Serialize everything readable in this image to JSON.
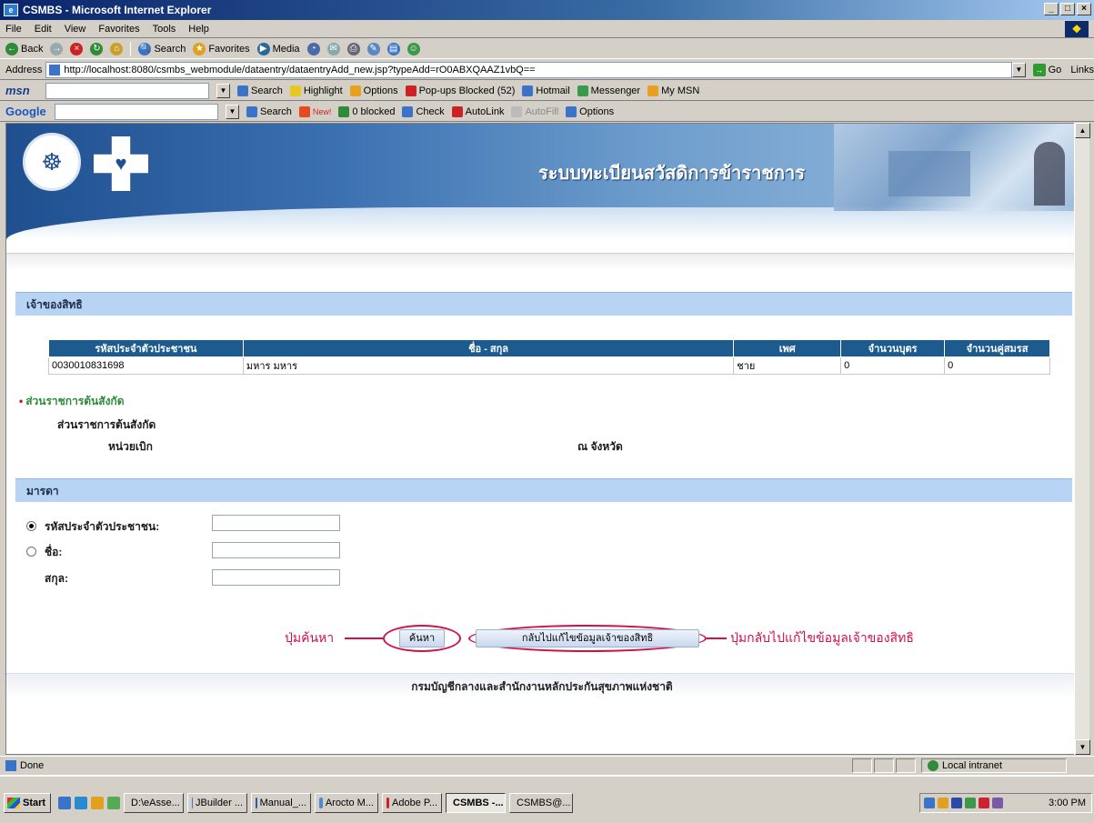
{
  "window": {
    "title": "CSMBS - Microsoft Internet Explorer",
    "buttons": [
      "_",
      "□",
      "×"
    ]
  },
  "menu": [
    "File",
    "Edit",
    "View",
    "Favorites",
    "Tools",
    "Help"
  ],
  "toolbar": {
    "back": "Back",
    "search": "Search",
    "favorites": "Favorites",
    "media": "Media"
  },
  "address": {
    "label": "Address",
    "url": "http://localhost:8080/csmbs_webmodule/dataentry/dataentryAdd_new.jsp?typeAdd=rO0ABXQAAZ1vbQ==",
    "go": "Go",
    "links": "Links"
  },
  "msn": {
    "logo": "msn",
    "search": "Search",
    "highlight": "Highlight",
    "options": "Options",
    "popups": "Pop-ups Blocked (52)",
    "hotmail": "Hotmail",
    "messenger": "Messenger",
    "mymsn": "My MSN"
  },
  "google": {
    "logo": "Google",
    "search": "Search",
    "new": "New!",
    "blocked": "0 blocked",
    "check": "Check",
    "autolink": "AutoLink",
    "autofill": "AutoFill",
    "options": "Options"
  },
  "banner": {
    "title": "ระบบทะเบียนสวัสดิการข้าราชการ"
  },
  "owner": {
    "header": "เจ้าของสิทธิ",
    "columns": [
      "รหัสประจำตัวประชาชน",
      "ชื่อ - สกุล",
      "เพศ",
      "จำนวนบุตร",
      "จำนวนคู่สมรส"
    ],
    "row": [
      "0030010831698",
      "มหาร มหาร",
      "ชาย",
      "0",
      "0"
    ]
  },
  "agency": {
    "link": "ส่วนราชการต้นสังกัด",
    "label": "ส่วนราชการต้นสังกัด",
    "unit": "หน่วยเบิก",
    "province": "ณ จังหวัด"
  },
  "mother": {
    "header": "มารดา",
    "id_label": "รหัสประจำตัวประชาชน:",
    "name_label": "ชื่อ:",
    "surname_label": "สกุล:"
  },
  "actions": {
    "search": "ค้นหา",
    "back": "กลับไปแก้ไขข้อมูลเจ้าของสิทธิ",
    "annot_search": "ปุ่มค้นหา",
    "annot_back": "ปุ่มกลับไปแก้ไขข้อมูลเจ้าของสิทธิ"
  },
  "footer": "กรมบัญชีกลางและสำนักงานหลักประกันสุขภาพแห่งชาติ",
  "status": {
    "text": "Done",
    "zone": "Local intranet"
  },
  "taskbar": {
    "start": "Start",
    "tasks": [
      "D:\\eAsse...",
      "JBuilder ...",
      "Manual_...",
      "Arocto M...",
      "Adobe P...",
      "CSMBS -...",
      "CSMBS@..."
    ],
    "clock": "3:00 PM"
  }
}
